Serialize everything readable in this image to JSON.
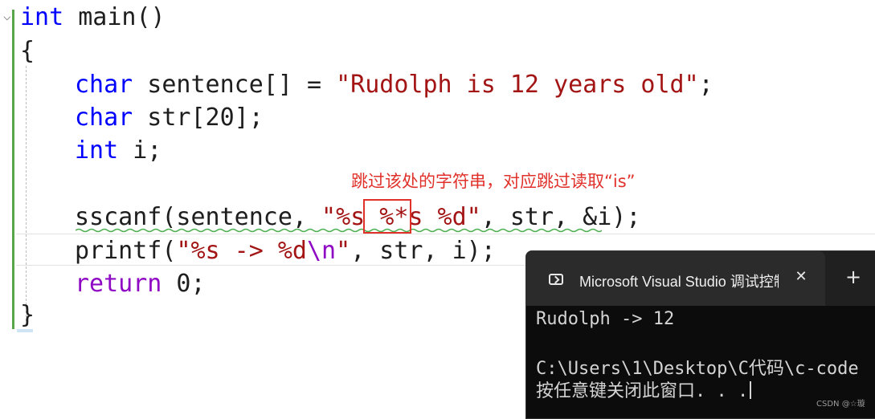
{
  "editor": {
    "lines": {
      "l1": {
        "kw": "int",
        "rest": " main()"
      },
      "l2": {
        "text": "{"
      },
      "l3": {
        "kw": "char",
        "mid": " sentence[] = ",
        "str": "\"Rudolph is 12 years old\"",
        "end": ";"
      },
      "l4": {
        "kw": "char",
        "rest": " str[20];"
      },
      "l5": {
        "kw": "int",
        "rest": " i;"
      },
      "l6": {
        "fn": "sscanf(sentence, ",
        "str1": "\"%s ",
        "str_highlight": "%*s",
        "str2": " %d\"",
        "rest": ", str, &i);"
      },
      "l7": {
        "fn": "printf(",
        "str1": "\"%s -> %d",
        "esc": "\\n",
        "str2": "\"",
        "rest": ", str, i);"
      },
      "l8": {
        "kw": "return",
        "rest": " 0;"
      },
      "l9": {
        "text": "}"
      }
    },
    "annotation": "跳过该处的字符串，对应跳过读取“is”"
  },
  "terminal": {
    "tab_title": "Microsoft Visual Studio 调试控制台",
    "close_glyph": "✕",
    "new_tab_glyph": "+",
    "output": {
      "line1": "Rudolph -> 12",
      "line2": "C:\\Users\\1\\Desktop\\C代码\\c-code",
      "line3": "按任意键关闭此窗口. . ."
    }
  },
  "watermark": "CSDN @☆璇",
  "colors": {
    "keyword": "#0000ff",
    "string": "#a31515",
    "annotation": "#e0312b",
    "terminal_bg": "#0c0c0c"
  }
}
